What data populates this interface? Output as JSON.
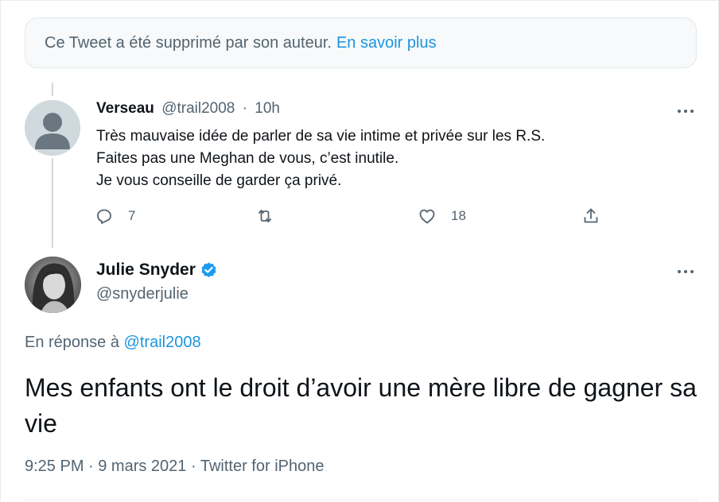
{
  "deleted_notice": {
    "text": "Ce Tweet a été supprimé par son auteur.",
    "link": "En savoir plus"
  },
  "reply": {
    "name": "Verseau",
    "handle": "@trail2008",
    "separator": "·",
    "time": "10h",
    "lines": [
      "Très mauvaise idée de parler de sa vie intime et privée sur les R.S.",
      "Faites pas une Meghan de vous, c’est inutile.",
      "Je vous conseille de garder ça privé."
    ],
    "reply_count": "7",
    "like_count": "18"
  },
  "main": {
    "name": "Julie Snyder",
    "handle": "@snyderjulie",
    "reply_label": "En réponse à",
    "reply_handle": "@trail2008",
    "text": "Mes enfants ont le droit d’avoir une mère libre de gagner sa vie",
    "meta": "9:25 PM · 9 mars 2021 · Twitter for iPhone"
  },
  "colors": {
    "link": "#1b95e0",
    "secondary_text": "#536471",
    "verified": "#1d9bf0"
  },
  "icons": [
    "reply-icon",
    "retweet-icon",
    "like-icon",
    "share-icon",
    "more-icon",
    "verified-badge-icon",
    "default-avatar-icon"
  ]
}
